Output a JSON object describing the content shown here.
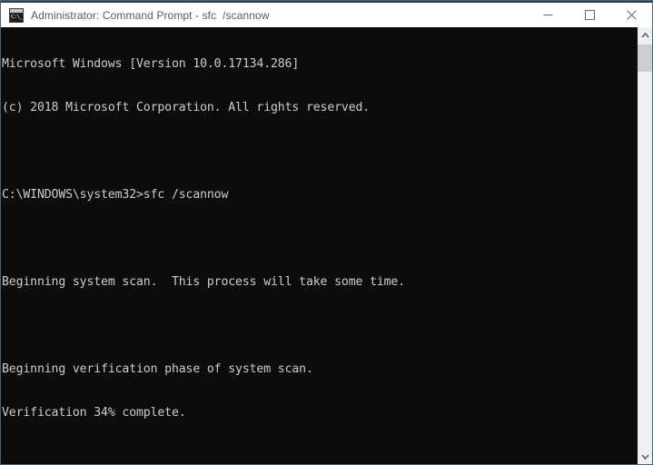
{
  "window": {
    "title": "Administrator: Command Prompt - sfc  /scannow",
    "icon": "cmd-icon",
    "icon_glyph": "C:\\_",
    "colors": {
      "titlebar_bg": "#ffffff",
      "title_text": "#5b5b5b",
      "console_bg": "#0c0c0c",
      "console_text": "#cccccc",
      "window_border": "#4a6275",
      "scrollbar_track": "#f0f0f0",
      "scrollbar_thumb": "#cdcdcd"
    },
    "controls": {
      "minimize_label": "Minimize",
      "maximize_label": "Maximize",
      "close_label": "Close"
    }
  },
  "console": {
    "lines": [
      "Microsoft Windows [Version 10.0.17134.286]",
      "(c) 2018 Microsoft Corporation. All rights reserved.",
      "",
      "C:\\WINDOWS\\system32>sfc /scannow",
      "",
      "Beginning system scan.  This process will take some time.",
      "",
      "Beginning verification phase of system scan.",
      "Verification 34% complete."
    ],
    "os_version": "10.0.17134.286",
    "copyright_year": "2018",
    "prompt_path": "C:\\WINDOWS\\system32",
    "command": "sfc /scannow",
    "progress_percent": "34%",
    "status": "Verification 34% complete."
  },
  "scrollbar": {
    "up_arrow": "chevron-up-icon",
    "down_arrow": "chevron-down-icon"
  }
}
